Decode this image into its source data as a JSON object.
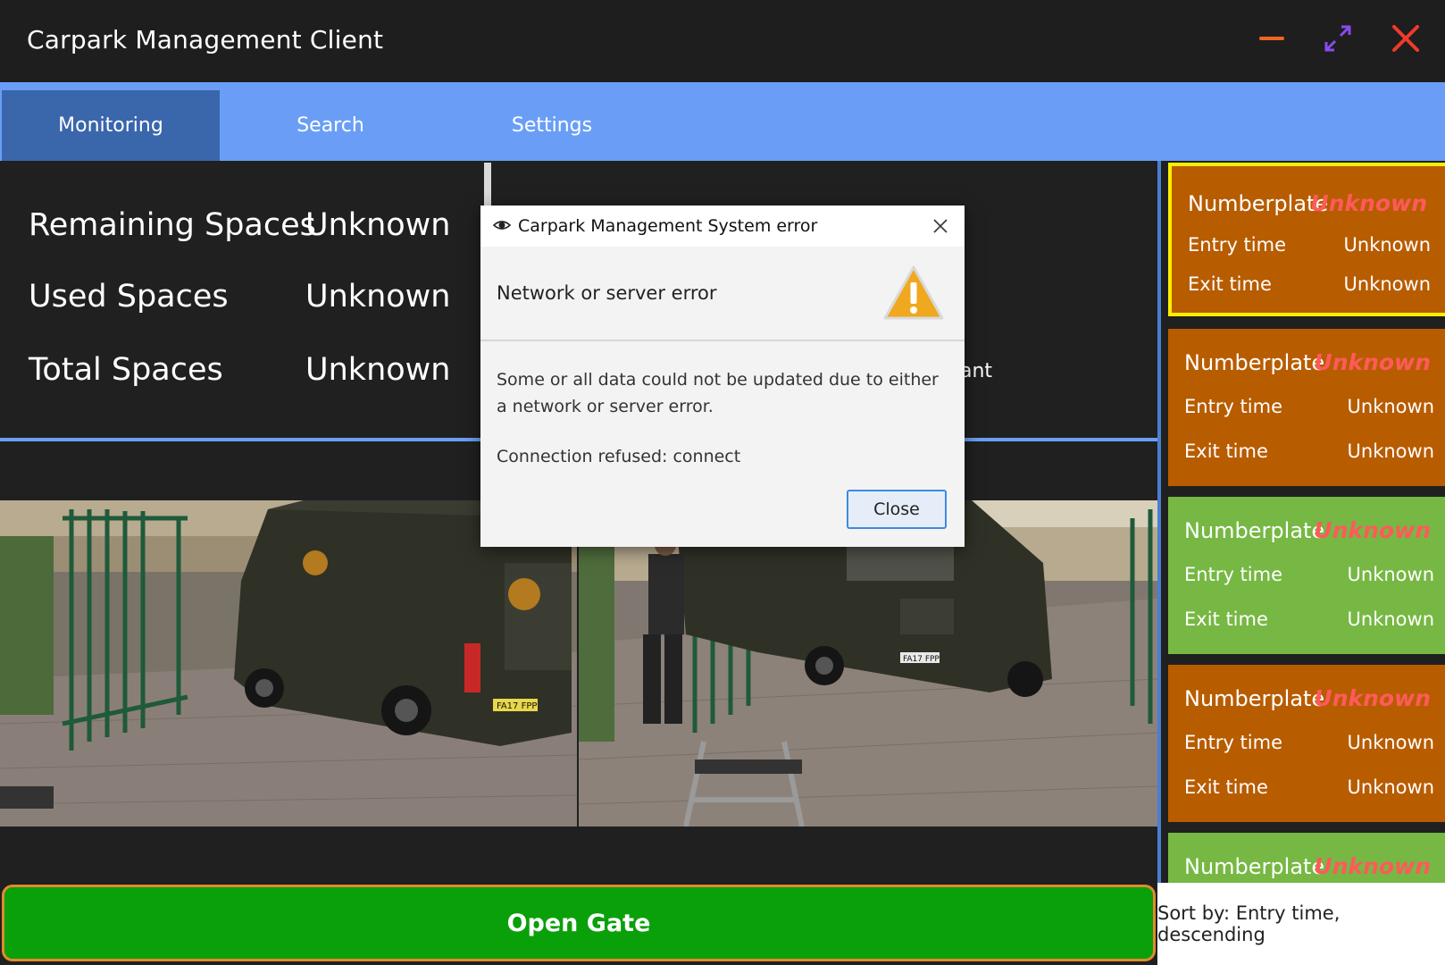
{
  "window": {
    "title": "Carpark Management Client",
    "controls": {
      "minimize": "minimize-icon",
      "maximize": "maximize-icon",
      "close": "close-icon"
    }
  },
  "tabs": [
    {
      "label": "Monitoring",
      "active": true
    },
    {
      "label": "Search",
      "active": false
    },
    {
      "label": "Settings",
      "active": false
    }
  ],
  "stats": {
    "remaining_label": "Remaining Spaces",
    "remaining_value": "Unknown",
    "used_label": "Used Spaces",
    "used_value": "Unknown",
    "total_label": "Total Spaces",
    "total_value": "Unknown",
    "partial_hidden_text": "ant"
  },
  "cameras": [
    {
      "name": "camera-view-1",
      "plate": "FA17 FPP"
    },
    {
      "name": "camera-view-2",
      "plate": "FA17 FPP"
    }
  ],
  "records": [
    {
      "np_label": "Numberplate",
      "np_value": "Unknown",
      "entry_label": "Entry time",
      "entry_value": "Unknown",
      "exit_label": "Exit time",
      "exit_value": "Unknown",
      "color": "#b85c00",
      "selected": true
    },
    {
      "np_label": "Numberplate",
      "np_value": "Unknown",
      "entry_label": "Entry time",
      "entry_value": "Unknown",
      "exit_label": "Exit time",
      "exit_value": "Unknown",
      "color": "#b85c00",
      "selected": false
    },
    {
      "np_label": "Numberplate",
      "np_value": "Unknown",
      "entry_label": "Entry time",
      "entry_value": "Unknown",
      "exit_label": "Exit time",
      "exit_value": "Unknown",
      "color": "#76b843",
      "selected": false
    },
    {
      "np_label": "Numberplate",
      "np_value": "Unknown",
      "entry_label": "Entry time",
      "entry_value": "Unknown",
      "exit_label": "Exit time",
      "exit_value": "Unknown",
      "color": "#b85c00",
      "selected": false
    },
    {
      "np_label": "Numberplate",
      "np_value": "Unknown",
      "color": "#76b843",
      "selected": false
    }
  ],
  "actions": {
    "open_gate": "Open Gate",
    "sort_by": "Sort by: Entry time, descending"
  },
  "dialog": {
    "title": "Carpark Management System error",
    "header": "Network or server error",
    "body": "Some or all data could not be updated due to either a network or server error.",
    "detail": "Connection refused: connect",
    "close_label": "Close"
  },
  "colors": {
    "tab_bar": "#6a9ef6",
    "tab_active": "#3a66ac",
    "open_gate": "#0aa00a",
    "card_orange": "#b85c00",
    "card_green": "#76b843",
    "unknown_red": "#ff5a5a",
    "selected_border": "#ffee00"
  }
}
